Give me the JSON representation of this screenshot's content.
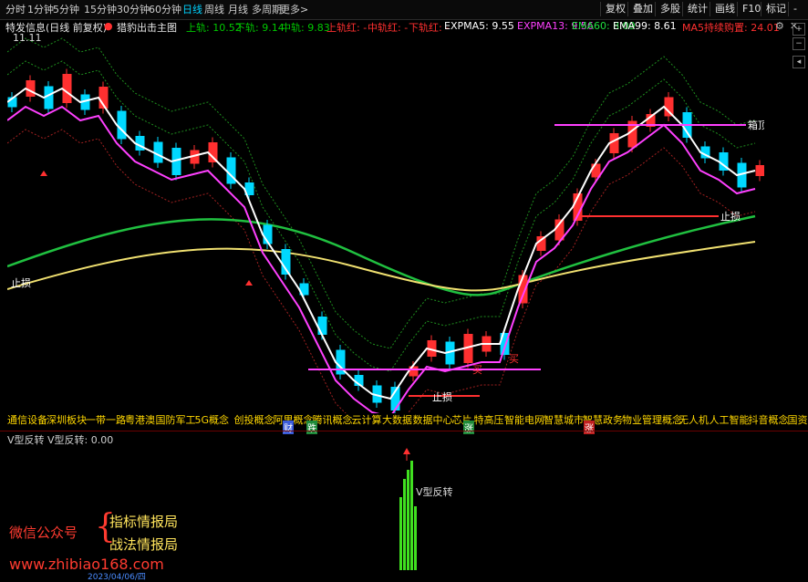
{
  "toolbar": {
    "periods": [
      "分时",
      "1分钟",
      "5分钟",
      "15分钟",
      "30分钟",
      "60分钟",
      "日线",
      "周线",
      "月线",
      "多周期",
      "更多>"
    ],
    "active_period": "日线",
    "right_buttons": [
      "复权",
      "叠加",
      "多股",
      "统计",
      "画线",
      "F10",
      "标记",
      "-"
    ]
  },
  "legend": {
    "stock": "特发信息(日线 前复权)",
    "indicator": "猎豹出击主图",
    "items": [
      {
        "text": "上轨: 10.52",
        "color": "#00c800"
      },
      {
        "text": "下轨: 9.14",
        "color": "#00c800"
      },
      {
        "text": "中轨: 9.83",
        "color": "#00c800"
      },
      {
        "text": "上轨红: -",
        "color": "#ff3030"
      },
      {
        "text": "中轨红: -",
        "color": "#ff3030"
      },
      {
        "text": "下轨红: -",
        "color": "#ff3030"
      },
      {
        "text": "EXPMA5: 9.55",
        "color": "#ffffff"
      },
      {
        "text": "EXPMA13: 9.56",
        "color": "#ff40ff"
      },
      {
        "text": "EMA60: 8.09",
        "color": "#20e040"
      },
      {
        "text": "EMA99: 8.61",
        "color": "#ffffff"
      },
      {
        "text": "MA5持续购置: 24.01",
        "color": "#ff3030"
      }
    ]
  },
  "chart": {
    "high_label": "11.11",
    "annotations": {
      "box_top": "箱顶",
      "stop_loss_right": "止损",
      "stop_loss_left": "止损",
      "stop_loss_bottom": "止损",
      "buy1": "买",
      "buy2": "买"
    },
    "colors": {
      "up": "#ff3030",
      "down": "#00d8ff",
      "ema13": "#ff40ff",
      "ema5": "#ffffff",
      "ema60": "#20c040",
      "ema99": "#f0e070"
    }
  },
  "concepts": {
    "items": [
      "通信设备",
      "深圳板块",
      "一带一路",
      "粤港澳",
      "国防军工",
      "5G概念",
      "创投概念",
      "阿里概念",
      "腾讯概念",
      "云计算",
      "大数据",
      "数据中心",
      "芯片",
      "特高压",
      "智能电网",
      "智慧城市",
      "智慧政务",
      "物业管理概念",
      "无人机",
      "人工智能",
      "抖音概念",
      "国资云"
    ],
    "tags": [
      {
        "text": "财",
        "color": "#3a5bd9"
      },
      {
        "text": "跌",
        "color": "#1f8b3a"
      },
      {
        "text": "涨",
        "color": "#1f8b3a"
      },
      {
        "text": "涨",
        "color": "#c02020"
      }
    ]
  },
  "sub": {
    "header": "V型反转 V型反转: 0.00",
    "signal_label": "V型反转"
  },
  "watermark": {
    "line1": "微信公众号",
    "line2": "指标情报局",
    "line3": "战法情报局",
    "url": "www.zhibiao168.com"
  },
  "bottom_axis": {
    "date": "2023/04/06/四"
  }
}
